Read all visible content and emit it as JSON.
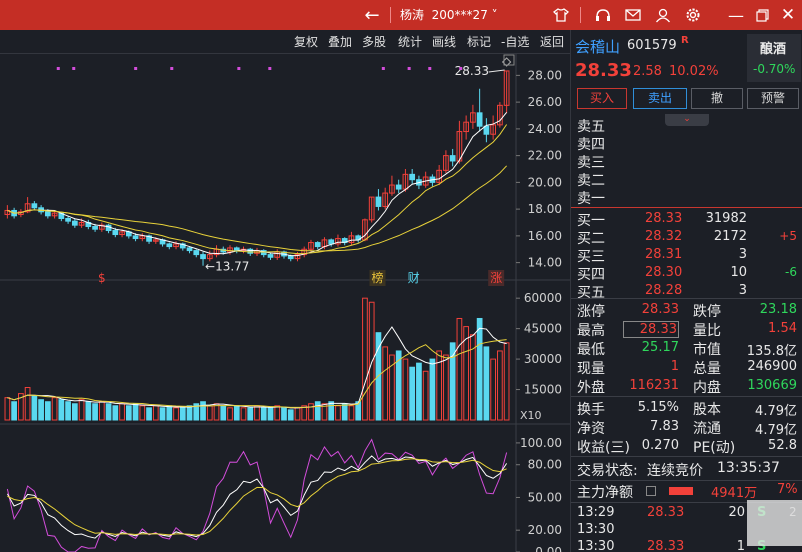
{
  "titlebar": {
    "back_icon": "arrow-left-icon",
    "user_name": "杨涛",
    "user_account": "200***27",
    "icons": [
      "shirt-icon",
      "headset-icon",
      "mail-icon",
      "user-icon",
      "gear-icon",
      "minimize-icon",
      "restore-icon",
      "close-icon"
    ]
  },
  "toolbar": {
    "items": [
      "复权",
      "叠加",
      "多股",
      "统计",
      "画线",
      "标记",
      "-自选",
      "返回"
    ]
  },
  "chart": {
    "price_axis": [
      "28.00",
      "26.00",
      "24.00",
      "22.00",
      "20.00",
      "18.00",
      "16.00",
      "14.00"
    ],
    "high_label": "28.33",
    "low_label": "←13.77",
    "markers": [
      "$",
      "榜",
      "财",
      "涨"
    ],
    "volume_axis": [
      "60000",
      "45000",
      "30000",
      "15000"
    ],
    "volume_unit": "X10",
    "indicator_axis": [
      "100.00",
      "80.00",
      "50.00",
      "20.00",
      "0.00"
    ]
  },
  "chart_data": {
    "type": "candlestick",
    "price_range": [
      13,
      29
    ],
    "candles": [
      {
        "o": 17.6,
        "c": 17.9,
        "h": 18.3,
        "l": 17.3
      },
      {
        "o": 17.9,
        "c": 17.5,
        "h": 18.1,
        "l": 17.3
      },
      {
        "o": 17.6,
        "c": 17.8,
        "h": 18.0,
        "l": 17.4
      },
      {
        "o": 17.8,
        "c": 18.4,
        "h": 18.9,
        "l": 17.7
      },
      {
        "o": 18.4,
        "c": 18.1,
        "h": 18.6,
        "l": 17.9
      },
      {
        "o": 18.1,
        "c": 17.8,
        "h": 18.3,
        "l": 17.6
      },
      {
        "o": 17.8,
        "c": 17.5,
        "h": 18.0,
        "l": 17.3
      },
      {
        "o": 17.5,
        "c": 17.7,
        "h": 17.9,
        "l": 17.3
      },
      {
        "o": 17.7,
        "c": 17.3,
        "h": 17.8,
        "l": 17.1
      },
      {
        "o": 17.3,
        "c": 17.1,
        "h": 17.5,
        "l": 16.9
      },
      {
        "o": 17.1,
        "c": 16.8,
        "h": 17.3,
        "l": 16.6
      },
      {
        "o": 16.8,
        "c": 17.0,
        "h": 17.3,
        "l": 16.6
      },
      {
        "o": 17.0,
        "c": 16.7,
        "h": 17.2,
        "l": 16.5
      },
      {
        "o": 16.7,
        "c": 16.5,
        "h": 16.9,
        "l": 16.3
      },
      {
        "o": 16.5,
        "c": 16.8,
        "h": 17.0,
        "l": 16.3
      },
      {
        "o": 16.8,
        "c": 16.4,
        "h": 16.9,
        "l": 16.2
      },
      {
        "o": 16.4,
        "c": 16.1,
        "h": 16.6,
        "l": 15.9
      },
      {
        "o": 16.1,
        "c": 16.3,
        "h": 16.5,
        "l": 15.9
      },
      {
        "o": 16.3,
        "c": 16.0,
        "h": 16.4,
        "l": 15.8
      },
      {
        "o": 16.0,
        "c": 15.8,
        "h": 16.2,
        "l": 15.6
      },
      {
        "o": 15.8,
        "c": 16.0,
        "h": 16.2,
        "l": 15.6
      },
      {
        "o": 16.0,
        "c": 15.6,
        "h": 16.1,
        "l": 15.4
      },
      {
        "o": 15.6,
        "c": 15.7,
        "h": 15.9,
        "l": 15.4
      },
      {
        "o": 15.7,
        "c": 15.4,
        "h": 15.8,
        "l": 15.2
      },
      {
        "o": 15.4,
        "c": 15.2,
        "h": 15.5,
        "l": 15.0
      },
      {
        "o": 15.2,
        "c": 15.4,
        "h": 15.6,
        "l": 15.0
      },
      {
        "o": 15.4,
        "c": 15.1,
        "h": 15.5,
        "l": 14.9
      },
      {
        "o": 15.1,
        "c": 14.9,
        "h": 15.2,
        "l": 14.7
      },
      {
        "o": 14.9,
        "c": 14.6,
        "h": 15.0,
        "l": 14.4
      },
      {
        "o": 14.6,
        "c": 14.3,
        "h": 14.8,
        "l": 13.77
      },
      {
        "o": 14.3,
        "c": 14.6,
        "h": 14.9,
        "l": 14.1
      },
      {
        "o": 14.6,
        "c": 15.0,
        "h": 15.3,
        "l": 14.4
      },
      {
        "o": 15.0,
        "c": 14.8,
        "h": 15.2,
        "l": 14.6
      },
      {
        "o": 14.8,
        "c": 15.1,
        "h": 15.3,
        "l": 14.6
      },
      {
        "o": 15.1,
        "c": 14.9,
        "h": 15.2,
        "l": 14.7
      },
      {
        "o": 14.9,
        "c": 15.0,
        "h": 15.2,
        "l": 14.7
      },
      {
        "o": 15.0,
        "c": 14.7,
        "h": 15.1,
        "l": 14.5
      },
      {
        "o": 14.7,
        "c": 14.9,
        "h": 15.1,
        "l": 14.5
      },
      {
        "o": 14.9,
        "c": 14.6,
        "h": 15.0,
        "l": 14.4
      },
      {
        "o": 14.6,
        "c": 14.4,
        "h": 14.7,
        "l": 14.2
      },
      {
        "o": 14.4,
        "c": 14.8,
        "h": 15.0,
        "l": 14.2
      },
      {
        "o": 14.8,
        "c": 14.5,
        "h": 14.9,
        "l": 14.3
      },
      {
        "o": 14.5,
        "c": 14.3,
        "h": 14.6,
        "l": 14.1
      },
      {
        "o": 14.3,
        "c": 14.6,
        "h": 14.8,
        "l": 14.1
      },
      {
        "o": 14.6,
        "c": 15.0,
        "h": 15.2,
        "l": 14.4
      },
      {
        "o": 15.0,
        "c": 15.5,
        "h": 15.7,
        "l": 14.8
      },
      {
        "o": 15.5,
        "c": 15.2,
        "h": 15.6,
        "l": 15.0
      },
      {
        "o": 15.2,
        "c": 15.7,
        "h": 15.9,
        "l": 15.0
      },
      {
        "o": 15.7,
        "c": 15.4,
        "h": 15.8,
        "l": 15.2
      },
      {
        "o": 15.4,
        "c": 15.8,
        "h": 16.1,
        "l": 15.2
      },
      {
        "o": 15.8,
        "c": 15.5,
        "h": 15.9,
        "l": 15.3
      },
      {
        "o": 15.5,
        "c": 16.0,
        "h": 16.3,
        "l": 15.3
      },
      {
        "o": 16.0,
        "c": 15.7,
        "h": 16.1,
        "l": 15.5
      },
      {
        "o": 15.7,
        "c": 17.2,
        "h": 17.3,
        "l": 15.6
      },
      {
        "o": 17.2,
        "c": 18.9,
        "h": 18.9,
        "l": 17.0
      },
      {
        "o": 18.9,
        "c": 18.2,
        "h": 19.5,
        "l": 17.9
      },
      {
        "o": 18.2,
        "c": 19.2,
        "h": 19.6,
        "l": 18.0
      },
      {
        "o": 19.2,
        "c": 19.8,
        "h": 20.5,
        "l": 19.0
      },
      {
        "o": 19.8,
        "c": 19.5,
        "h": 20.2,
        "l": 19.2
      },
      {
        "o": 19.5,
        "c": 20.6,
        "h": 21.0,
        "l": 19.3
      },
      {
        "o": 20.6,
        "c": 20.2,
        "h": 21.0,
        "l": 19.9
      },
      {
        "o": 20.2,
        "c": 19.8,
        "h": 20.5,
        "l": 19.5
      },
      {
        "o": 19.8,
        "c": 20.4,
        "h": 20.8,
        "l": 19.6
      },
      {
        "o": 20.4,
        "c": 20.0,
        "h": 20.6,
        "l": 19.7
      },
      {
        "o": 20.0,
        "c": 20.9,
        "h": 21.3,
        "l": 19.8
      },
      {
        "o": 20.9,
        "c": 22.0,
        "h": 22.4,
        "l": 20.7
      },
      {
        "o": 22.0,
        "c": 21.6,
        "h": 22.5,
        "l": 21.2
      },
      {
        "o": 21.6,
        "c": 23.8,
        "h": 24.6,
        "l": 21.4
      },
      {
        "o": 23.8,
        "c": 24.5,
        "h": 25.0,
        "l": 23.2
      },
      {
        "o": 24.5,
        "c": 25.2,
        "h": 25.8,
        "l": 24.0
      },
      {
        "o": 25.2,
        "c": 24.2,
        "h": 27.0,
        "l": 23.8
      },
      {
        "o": 24.2,
        "c": 23.6,
        "h": 24.8,
        "l": 23.0
      },
      {
        "o": 23.6,
        "c": 24.3,
        "h": 25.0,
        "l": 23.2
      },
      {
        "o": 24.3,
        "c": 25.76,
        "h": 26.0,
        "l": 24.1
      },
      {
        "o": 25.76,
        "c": 28.33,
        "h": 28.33,
        "l": 25.17
      }
    ],
    "volume_range": [
      0,
      66000
    ],
    "volumes": [
      11000,
      9000,
      13000,
      16000,
      12000,
      10000,
      9000,
      11000,
      10000,
      9000,
      8000,
      10000,
      9000,
      8000,
      9000,
      8000,
      7000,
      8000,
      7000,
      8000,
      7000,
      6000,
      7000,
      6000,
      7000,
      6000,
      6000,
      7000,
      8000,
      9000,
      7000,
      8000,
      7000,
      6000,
      7000,
      6000,
      6000,
      7000,
      6000,
      6000,
      7000,
      6000,
      5000,
      6000,
      7000,
      8000,
      9000,
      8000,
      9000,
      7000,
      8000,
      7000,
      9000,
      60000,
      58000,
      43000,
      36000,
      32000,
      34000,
      30000,
      26000,
      28000,
      24000,
      30000,
      34000,
      32000,
      38000,
      50000,
      46000,
      42000,
      50000,
      36000,
      30000,
      34000,
      38000
    ],
    "indicator_range": [
      0,
      110
    ]
  },
  "stock": {
    "name": "会稽山",
    "code": "601579",
    "badge": "R",
    "price": "28.33",
    "change": "2.58",
    "change_pct": "10.02%",
    "sector": "酿酒",
    "sector_pct": "-0.70%"
  },
  "buttons": [
    "买入",
    "卖出",
    "撤",
    "预警"
  ],
  "sell_levels": [
    "卖五",
    "卖四",
    "卖三",
    "卖二",
    "卖一"
  ],
  "buy_levels": [
    {
      "label": "买一",
      "price": "28.33",
      "volume": "31982",
      "delta": ""
    },
    {
      "label": "买二",
      "price": "28.32",
      "volume": "2172",
      "delta": "+5"
    },
    {
      "label": "买三",
      "price": "28.31",
      "volume": "3",
      "delta": ""
    },
    {
      "label": "买四",
      "price": "28.30",
      "volume": "10",
      "delta": "-6"
    },
    {
      "label": "买五",
      "price": "28.28",
      "volume": "3",
      "delta": ""
    }
  ],
  "stats": [
    {
      "l1": "涨停",
      "v1": "28.33",
      "l2": "跌停",
      "v2": "23.18"
    },
    {
      "l1": "最高",
      "v1": "28.33",
      "l2": "量比",
      "v2": "1.54"
    },
    {
      "l1": "最低",
      "v1": "25.17",
      "l2": "市值",
      "v2": "135.8亿"
    },
    {
      "l1": "现量",
      "v1": "1",
      "l2": "总量",
      "v2": "246900"
    },
    {
      "l1": "外盘",
      "v1": "116231",
      "l2": "内盘",
      "v2": "130669"
    }
  ],
  "fundamentals": [
    {
      "l1": "换手",
      "v1": "5.15%",
      "l2": "股本",
      "v2": "4.79亿"
    },
    {
      "l1": "净资",
      "v1": "7.83",
      "l2": "流通",
      "v2": "4.79亿"
    },
    {
      "l1": "收益(三)",
      "v1": "0.270",
      "l2": "PE(动)",
      "v2": "52.8"
    }
  ],
  "status": {
    "label": "交易状态:",
    "value": "连续竞价",
    "time": "13:35:37"
  },
  "capital": {
    "label": "主力净额",
    "value": "4941万",
    "pct": "7%"
  },
  "ticks": [
    {
      "time": "13:29",
      "price": "28.33",
      "vol": "20",
      "side": "S",
      "count": "2"
    },
    {
      "time": "13:30",
      "price": "",
      "vol": "",
      "side": "",
      "count": ""
    },
    {
      "time": "13:30",
      "price": "28.33",
      "vol": "1",
      "side": "S",
      "count": ""
    }
  ]
}
